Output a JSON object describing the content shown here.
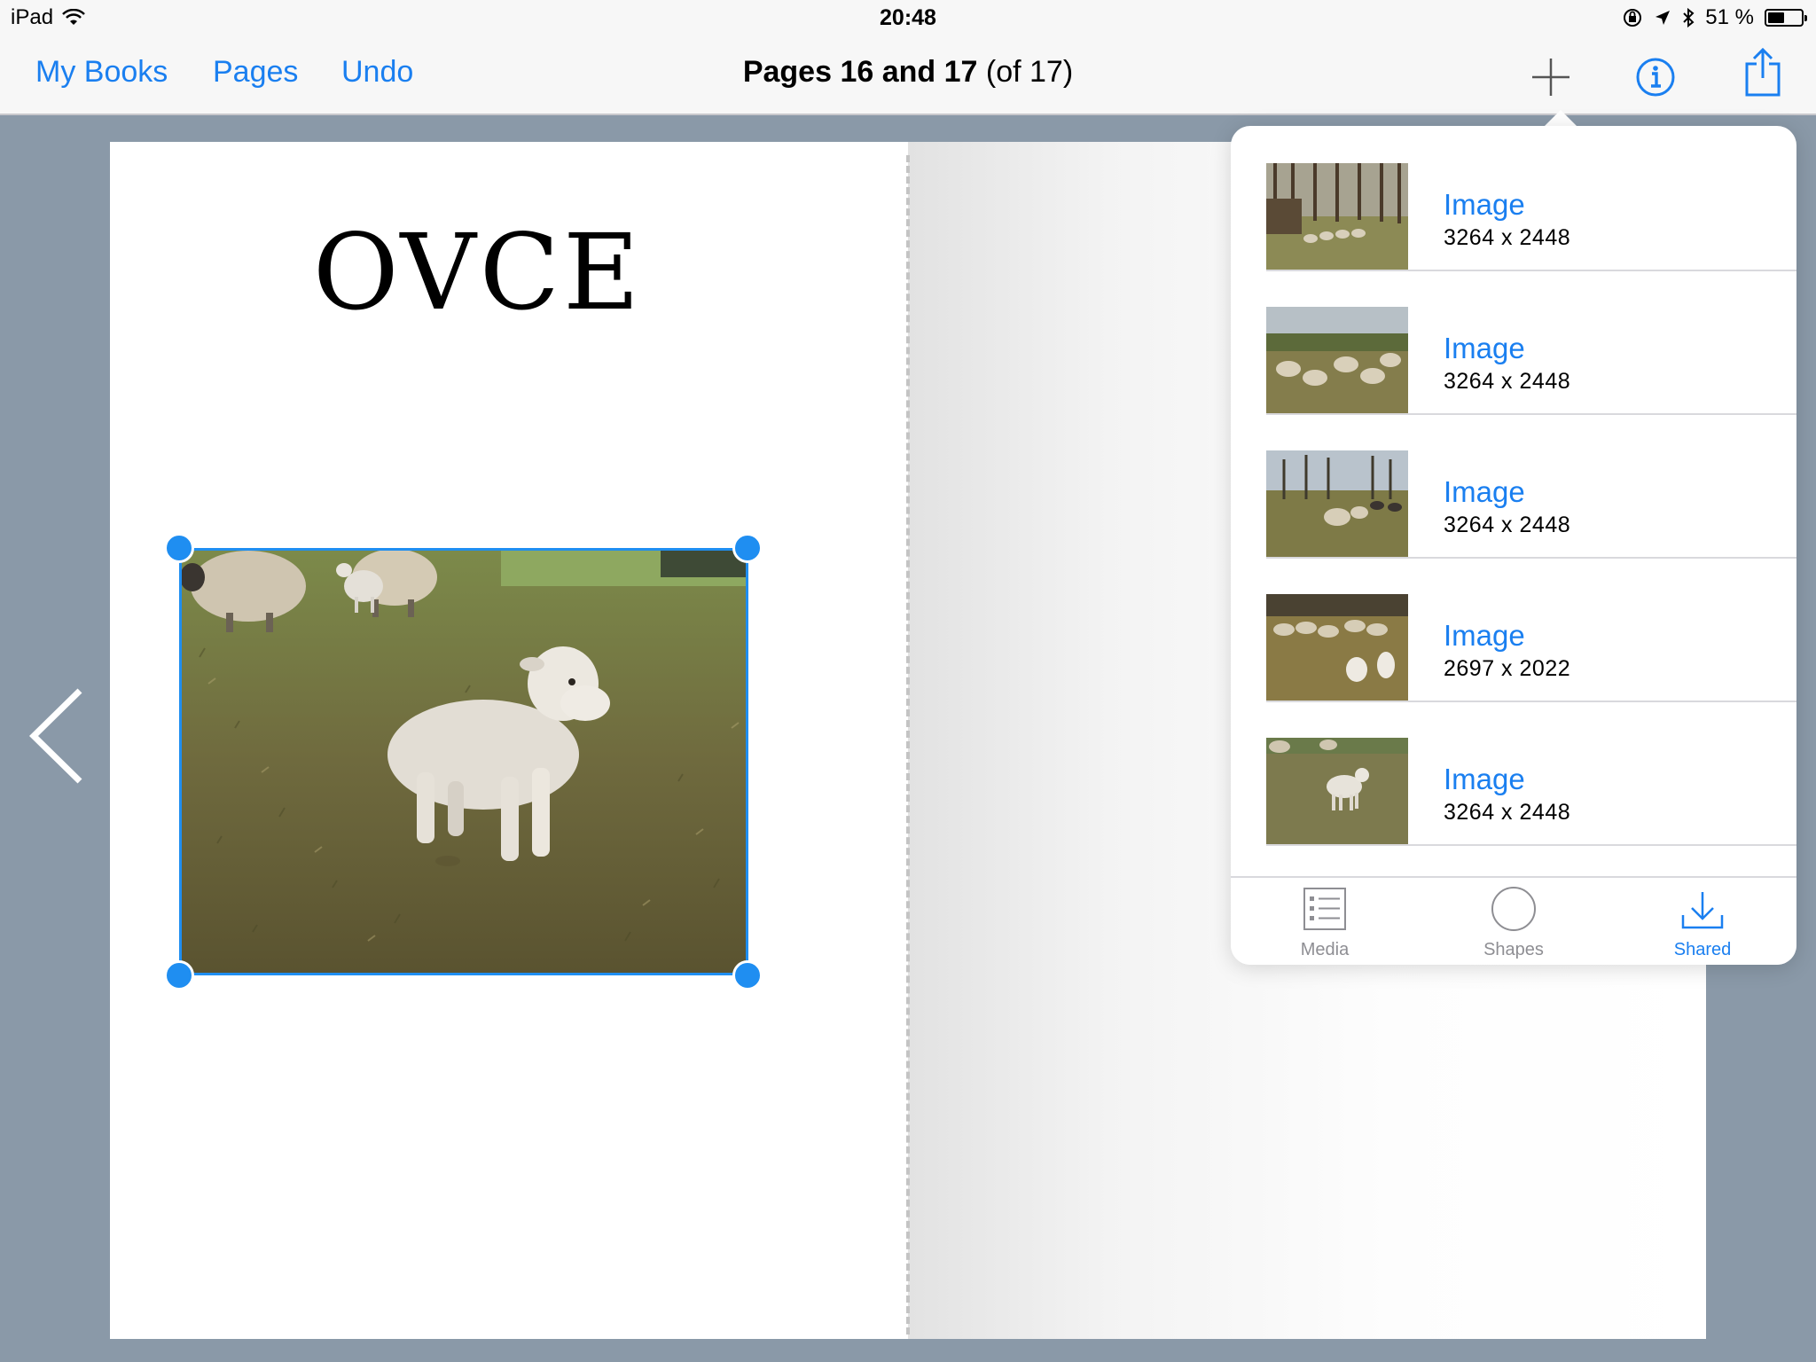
{
  "status_bar": {
    "device": "iPad",
    "time": "20:48",
    "battery_text": "51 %",
    "battery_level": 0.51
  },
  "nav": {
    "my_books": "My Books",
    "pages": "Pages",
    "undo": "Undo",
    "title_bold": "Pages 16 and 17",
    "title_rest": " (of 17)",
    "icons": [
      "plus-icon",
      "info-icon",
      "share-icon"
    ]
  },
  "page": {
    "heading": "OVCE"
  },
  "popover": {
    "images": [
      {
        "label": "Image",
        "dims": "3264 x 2448"
      },
      {
        "label": "Image",
        "dims": "3264 x 2448"
      },
      {
        "label": "Image",
        "dims": "3264 x 2448"
      },
      {
        "label": "Image",
        "dims": "2697 x 2022"
      },
      {
        "label": "Image",
        "dims": "3264 x 2448"
      }
    ],
    "tabs": [
      {
        "label": "Media",
        "icon": "list-icon"
      },
      {
        "label": "Shapes",
        "icon": "circle-icon"
      },
      {
        "label": "Shared",
        "icon": "download-icon",
        "active": true
      }
    ]
  },
  "colors": {
    "accent": "#1a7ff0",
    "background": "#8a99a8",
    "selection": "#1f8ef1"
  }
}
